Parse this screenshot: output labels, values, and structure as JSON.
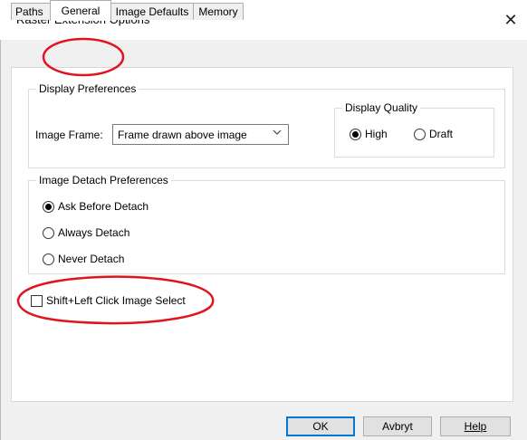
{
  "window": {
    "title": "Raster Extension Options",
    "close_glyph": "✕"
  },
  "tabs": [
    {
      "label": "Paths"
    },
    {
      "label": "General"
    },
    {
      "label": "Image Defaults"
    },
    {
      "label": "Memory"
    }
  ],
  "display_preferences": {
    "title": "Display Preferences",
    "image_frame": {
      "label": "Image Frame:",
      "value": "Frame drawn above image"
    },
    "display_quality": {
      "title": "Display Quality",
      "options": [
        {
          "label": "High",
          "selected": true
        },
        {
          "label": "Draft",
          "selected": false
        }
      ]
    }
  },
  "image_detach_preferences": {
    "title": "Image Detach Preferences",
    "options": [
      {
        "label": "Ask Before Detach",
        "selected": true
      },
      {
        "label": "Always Detach",
        "selected": false
      },
      {
        "label": "Never Detach",
        "selected": false
      }
    ]
  },
  "shift_click": {
    "label": "Shift+Left Click Image Select",
    "checked": false
  },
  "buttons": {
    "ok": "OK",
    "cancel": "Avbryt",
    "help": "Help"
  },
  "annotation_color": "#e0141e",
  "icons": {
    "close": "close-icon",
    "dropdown": "chevron-down-icon"
  }
}
